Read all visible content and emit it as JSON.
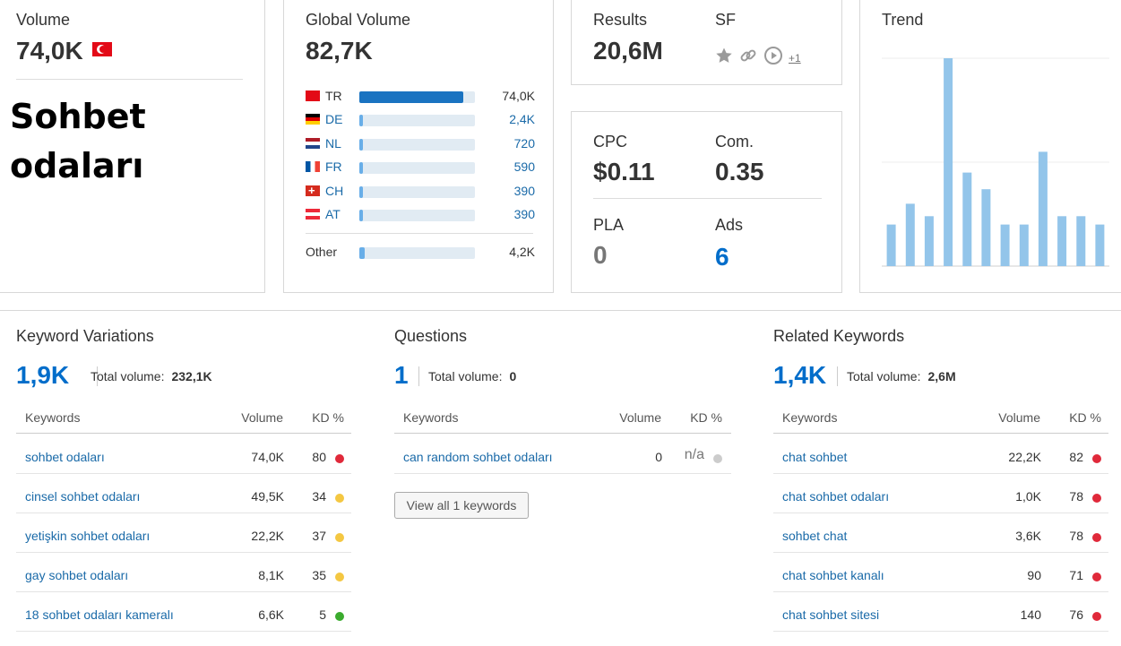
{
  "volume": {
    "label": "Volume",
    "value": "74,0K",
    "keyword": "Sohbet odaları",
    "keyword_line1": "Sohbet",
    "keyword_line2": "odaları"
  },
  "global": {
    "label": "Global Volume",
    "value": "82,7K",
    "countries": [
      {
        "code": "TR",
        "value": "74,0K",
        "share": 0.9
      },
      {
        "code": "DE",
        "value": "2,4K",
        "share": 0.03
      },
      {
        "code": "NL",
        "value": "720",
        "share": 0.02
      },
      {
        "code": "FR",
        "value": "590",
        "share": 0.02
      },
      {
        "code": "CH",
        "value": "390",
        "share": 0.02
      },
      {
        "code": "AT",
        "value": "390",
        "share": 0.02
      }
    ],
    "other": {
      "code": "Other",
      "value": "4,2K",
      "share": 0.05
    }
  },
  "results": {
    "label": "Results",
    "value": "20,6M",
    "sf_label": "SF",
    "sf_more": "+1",
    "sf_icons": [
      "star-icon",
      "link-icon",
      "video-icon"
    ]
  },
  "cpc": {
    "label": "CPC",
    "value": "$0.11"
  },
  "com": {
    "label": "Com.",
    "value": "0.35"
  },
  "pla": {
    "label": "PLA",
    "value": "0"
  },
  "ads": {
    "label": "Ads",
    "value": "6"
  },
  "trend": {
    "label": "Trend"
  },
  "chart_data": {
    "type": "bar",
    "title": "Trend",
    "categories": [
      "1",
      "2",
      "3",
      "4",
      "5",
      "6",
      "7",
      "8",
      "9",
      "10",
      "11",
      "12"
    ],
    "values": [
      20,
      30,
      24,
      100,
      45,
      37,
      20,
      20,
      55,
      24,
      24,
      20
    ],
    "ylim": [
      0,
      100
    ],
    "grid": true,
    "color": "#93c5ea"
  },
  "variations": {
    "title": "Keyword Variations",
    "count": "1,9K",
    "total_label": "Total volume:",
    "total_value": "232,1K",
    "headers": {
      "keyword": "Keywords",
      "volume": "Volume",
      "kd": "KD %"
    },
    "rows": [
      {
        "keyword": "sohbet odaları",
        "volume": "74,0K",
        "kd": "80",
        "color": "#e0293a"
      },
      {
        "keyword": "cinsel sohbet odaları",
        "volume": "49,5K",
        "kd": "34",
        "color": "#f4c742"
      },
      {
        "keyword": "yetişkin sohbet odaları",
        "volume": "22,2K",
        "kd": "37",
        "color": "#f4c742"
      },
      {
        "keyword": "gay sohbet odaları",
        "volume": "8,1K",
        "kd": "35",
        "color": "#f4c742"
      },
      {
        "keyword": "18 sohbet odaları kameralı",
        "volume": "6,6K",
        "kd": "5",
        "color": "#3bab2e"
      }
    ]
  },
  "questions": {
    "title": "Questions",
    "count": "1",
    "total_label": "Total volume:",
    "total_value": "0",
    "headers": {
      "keyword": "Keywords",
      "volume": "Volume",
      "kd": "KD %"
    },
    "rows": [
      {
        "keyword": "can random sohbet odaları",
        "volume": "0",
        "kd": "n/a",
        "color": "#cccccc"
      }
    ],
    "view_all": "View all 1 keywords"
  },
  "related": {
    "title": "Related Keywords",
    "count": "1,4K",
    "total_label": "Total volume:",
    "total_value": "2,6M",
    "headers": {
      "keyword": "Keywords",
      "volume": "Volume",
      "kd": "KD %"
    },
    "rows": [
      {
        "keyword": "chat sohbet",
        "volume": "22,2K",
        "kd": "82",
        "color": "#e0293a"
      },
      {
        "keyword": "chat sohbet odaları",
        "volume": "1,0K",
        "kd": "78",
        "color": "#e0293a"
      },
      {
        "keyword": "sohbet chat",
        "volume": "3,6K",
        "kd": "78",
        "color": "#e0293a"
      },
      {
        "keyword": "chat sohbet kanalı",
        "volume": "90",
        "kd": "71",
        "color": "#e0293a"
      },
      {
        "keyword": "chat sohbet sitesi",
        "volume": "140",
        "kd": "76",
        "color": "#e0293a"
      }
    ]
  }
}
